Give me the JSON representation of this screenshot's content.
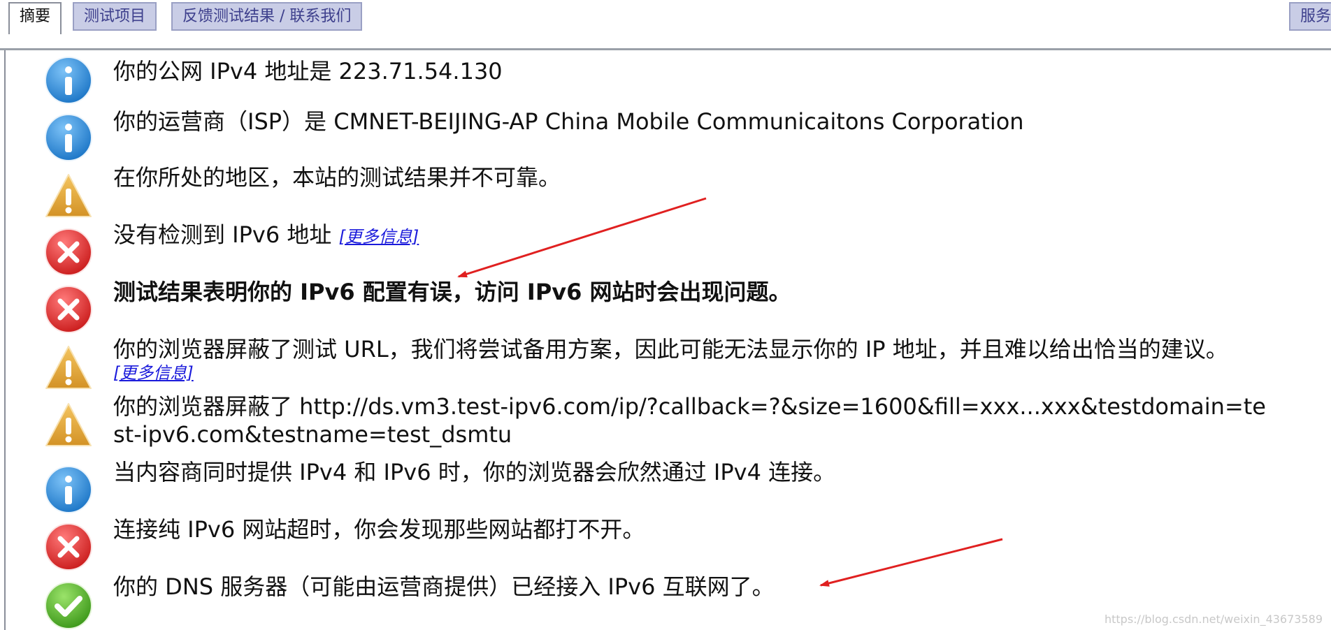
{
  "tabs": [
    {
      "label": "摘要",
      "active": true
    },
    {
      "label": "测试项目",
      "active": false
    },
    {
      "label": "反馈测试结果 / 联系我们",
      "active": false
    },
    {
      "label": "服务",
      "active": false
    }
  ],
  "results": [
    {
      "icon": "info-icon",
      "text": "你的公网 IPv4 地址是 223.71.54.130"
    },
    {
      "icon": "info-icon",
      "text": "你的运营商（ISP）是 CMNET-BEIJING-AP China Mobile Communicaitons Corporation"
    },
    {
      "icon": "warning-icon",
      "text": "在你所处的地区，本站的测试结果并不可靠。"
    },
    {
      "icon": "error-icon",
      "text": "没有检测到 IPv6 地址",
      "link": "[更多信息]"
    },
    {
      "icon": "error-icon",
      "text": "测试结果表明你的 IPv6 配置有误，访问 IPv6 网站时会出现问题。",
      "bold": true
    },
    {
      "icon": "warning-icon",
      "text": "你的浏览器屏蔽了测试 URL，我们将尝试备用方案，因此可能无法显示你的 IP 地址，并且难以给出恰当的建议。",
      "link": "[更多信息]"
    },
    {
      "icon": "warning-icon",
      "text": "你的浏览器屏蔽了 http://ds.vm3.test-ipv6.com/ip/?callback=?&size=1600&fill=xxx...xxx&testdomain=test-ipv6.com&testname=test_dsmtu"
    },
    {
      "icon": "info-icon",
      "text": "当内容商同时提供 IPv4 和 IPv6 时，你的浏览器会欣然通过 IPv4 连接。"
    },
    {
      "icon": "error-icon",
      "text": "连接纯 IPv6 网站超时，你会发现那些网站都打不开。"
    },
    {
      "icon": "success-icon",
      "text": "你的 DNS 服务器（可能由运营商提供）已经接入 IPv6 互联网了。"
    }
  ],
  "watermark": "https://blog.csdn.net/weixin_43673589",
  "colors": {
    "info": "#2e8fe0",
    "warning": "#e2a73a",
    "error": "#e23838",
    "success": "#5cb830",
    "tab_bg": "#c9cde6",
    "link": "#1a1adb",
    "annotation_arrow": "#e02020"
  }
}
